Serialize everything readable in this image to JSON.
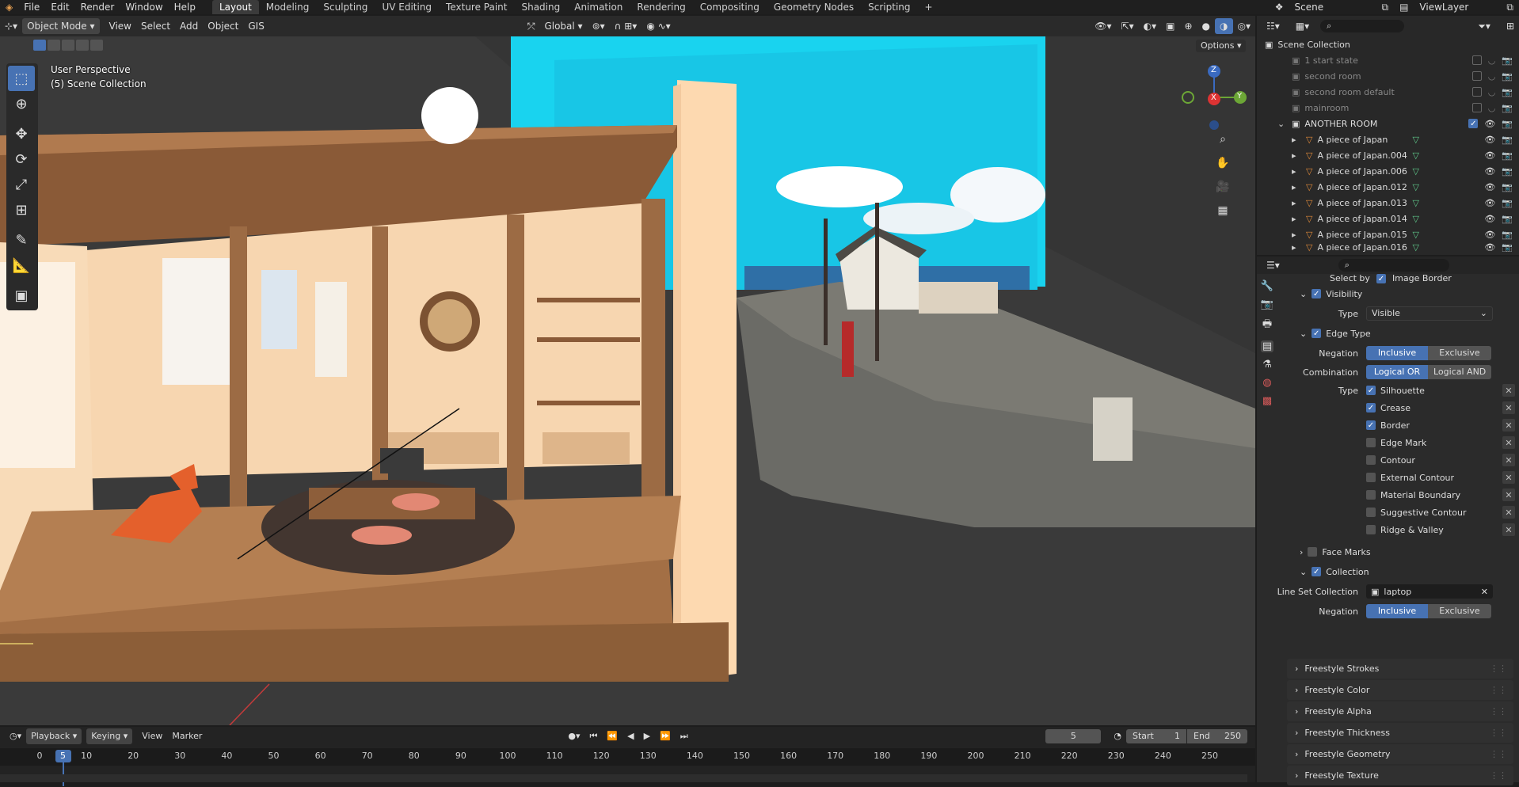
{
  "menubar": {
    "items": [
      "File",
      "Edit",
      "Render",
      "Window",
      "Help"
    ],
    "workspaces": [
      "Layout",
      "Modeling",
      "Sculpting",
      "UV Editing",
      "Texture Paint",
      "Shading",
      "Animation",
      "Rendering",
      "Compositing",
      "Geometry Nodes",
      "Scripting"
    ],
    "active_workspace": "Layout",
    "scene": "Scene",
    "view_layer": "ViewLayer"
  },
  "viewport_header": {
    "mode": "Object Mode",
    "menus": [
      "View",
      "Select",
      "Add",
      "Object",
      "GIS"
    ],
    "orientation": "Global",
    "options": "Options"
  },
  "viewport": {
    "perspective": "User Perspective",
    "collection": "(5) Scene Collection",
    "axes": {
      "z": "Z",
      "x": "X",
      "y": "Y"
    }
  },
  "timeline": {
    "menus": [
      "Playback",
      "Keying",
      "View",
      "Marker"
    ],
    "current_frame": "5",
    "start_label": "Start",
    "start": "1",
    "end_label": "End",
    "end": "250",
    "ticks": [
      "0",
      "10",
      "20",
      "30",
      "40",
      "50",
      "60",
      "70",
      "80",
      "90",
      "100",
      "110",
      "120",
      "130",
      "140",
      "150",
      "160",
      "170",
      "180",
      "190",
      "200",
      "210",
      "220",
      "230",
      "240",
      "250"
    ]
  },
  "outliner": {
    "root": "Scene Collection",
    "collections": [
      "1 start state",
      "second room",
      "second room default",
      "mainroom",
      "ANOTHER ROOM"
    ],
    "objects": [
      "A piece of Japan",
      "A piece of Japan.004",
      "A piece of Japan.006",
      "A piece of Japan.012",
      "A piece of Japan.013",
      "A piece of Japan.014",
      "A piece of Japan.015",
      "A piece of Japan.016"
    ]
  },
  "properties": {
    "select_by": "Select by",
    "image_border": "Image Border",
    "visibility": {
      "label": "Visibility",
      "type_label": "Type",
      "type_value": "Visible"
    },
    "edge_type": {
      "label": "Edge Type",
      "negation_label": "Negation",
      "negation": [
        "Inclusive",
        "Exclusive"
      ],
      "combination_label": "Combination",
      "combination": [
        "Logical OR",
        "Logical AND"
      ],
      "type_label": "Type",
      "types": [
        {
          "name": "Silhouette",
          "on": true
        },
        {
          "name": "Crease",
          "on": true
        },
        {
          "name": "Border",
          "on": true
        },
        {
          "name": "Edge Mark",
          "on": false
        },
        {
          "name": "Contour",
          "on": false
        },
        {
          "name": "External Contour",
          "on": false
        },
        {
          "name": "Material Boundary",
          "on": false
        },
        {
          "name": "Suggestive Contour",
          "on": false
        },
        {
          "name": "Ridge & Valley",
          "on": false
        }
      ]
    },
    "face_marks": "Face Marks",
    "collection": {
      "label": "Collection",
      "lineset_label": "Line Set Collection",
      "lineset_value": "laptop",
      "negation_label": "Negation",
      "negation": [
        "Inclusive",
        "Exclusive"
      ]
    },
    "panels": [
      "Freestyle Strokes",
      "Freestyle Color",
      "Freestyle Alpha",
      "Freestyle Thickness",
      "Freestyle Geometry",
      "Freestyle Texture"
    ]
  },
  "colors": {
    "accent": "#4772b3",
    "sky": "#19d3ef",
    "orange": "#e08a3a"
  }
}
